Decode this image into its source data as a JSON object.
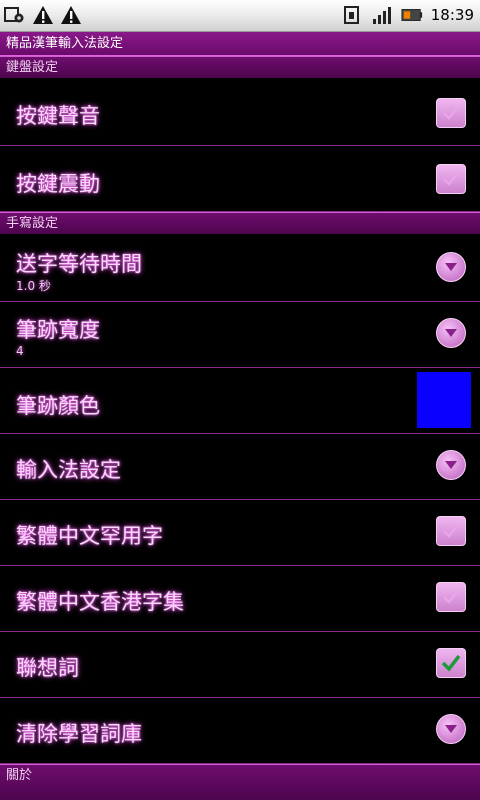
{
  "status_bar": {
    "time": "18:39",
    "icons_left": [
      "app-icon",
      "warning-icon",
      "warning-icon"
    ],
    "icons_right": [
      "sim-icon",
      "signal-icon",
      "battery-icon"
    ]
  },
  "app": {
    "title": "精品漢筆輸入法設定"
  },
  "sections": {
    "keyboard": "鍵盤設定",
    "handwriting": "手寫設定",
    "about": "關於"
  },
  "settings": {
    "key_sound": {
      "title": "按鍵聲音",
      "checked": false
    },
    "key_vibration": {
      "title": "按鍵震動",
      "checked": false
    },
    "send_wait_time": {
      "title": "送字等待時間",
      "summary": "1.0 秒"
    },
    "stroke_width": {
      "title": "筆跡寬度",
      "summary": "4"
    },
    "stroke_color": {
      "title": "筆跡顏色",
      "color": "#0a00ff"
    },
    "input_method_settings": {
      "title": "輸入法設定"
    },
    "rare_chars": {
      "title": "繁體中文罕用字",
      "checked": false
    },
    "hk_charset": {
      "title": "繁體中文香港字集",
      "checked": false
    },
    "association": {
      "title": "聯想詞",
      "checked": true
    },
    "clear_learning": {
      "title": "清除學習詞庫"
    }
  },
  "colors": {
    "accent": "#8a198a",
    "section_bg": "#5e095e",
    "check_mark": "#2fa64a"
  }
}
